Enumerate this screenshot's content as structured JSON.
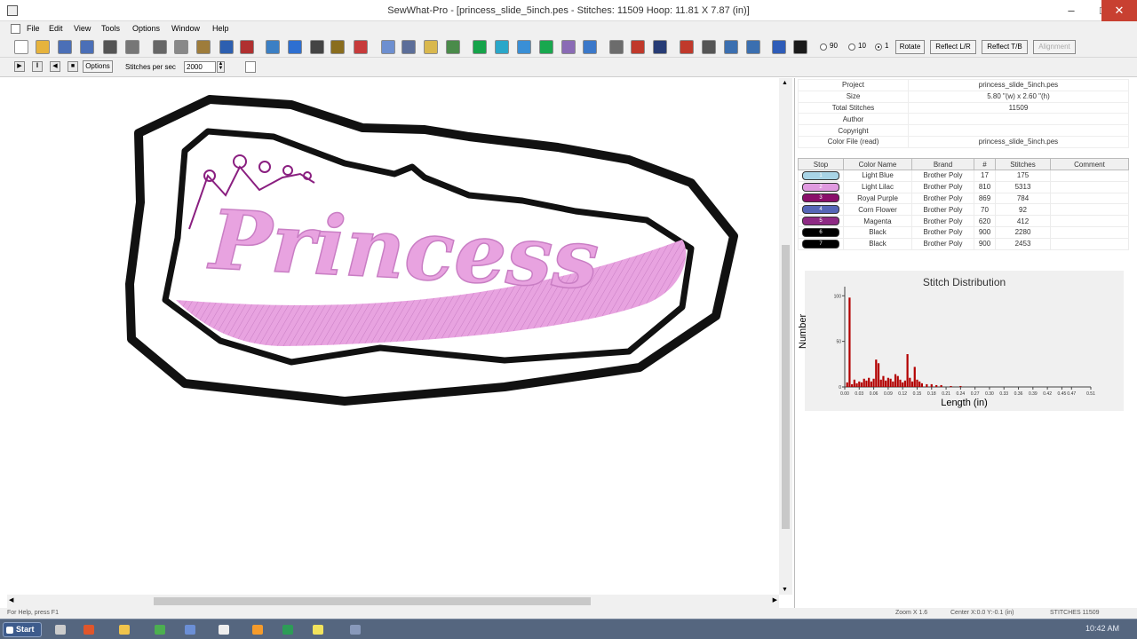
{
  "window": {
    "title": "SewWhat-Pro - [princess_slide_5inch.pes - Stitches: 11509  Hoop: 11.81 X 7.87 (in)]",
    "min_glyph": "–",
    "max_glyph": "□",
    "close_glyph": "✕"
  },
  "menu": [
    "File",
    "Edit",
    "View",
    "Tools",
    "Options",
    "Window",
    "Help"
  ],
  "toolbar": {
    "icons": [
      {
        "name": "new-file-icon",
        "color": "#ffffff"
      },
      {
        "name": "open-folder-icon",
        "color": "#e6b33d"
      },
      {
        "name": "save-icon",
        "color": "#4b6fb7"
      },
      {
        "name": "save-as-icon",
        "color": "#4b6fb7"
      },
      {
        "name": "print-icon",
        "color": "#555555"
      },
      {
        "name": "print-preview-icon",
        "color": "#777777"
      },
      {
        "name": "cut-icon",
        "color": "#666666"
      },
      {
        "name": "copy-icon",
        "color": "#888888"
      },
      {
        "name": "paste-icon",
        "color": "#9e7c3b"
      },
      {
        "name": "undo-icon",
        "color": "#2d5fb0"
      },
      {
        "name": "edit-stitches-icon",
        "color": "#b03030"
      },
      {
        "name": "hoop-icon",
        "color": "#3b7fc4"
      },
      {
        "name": "split-icon",
        "color": "#2e6fd1"
      },
      {
        "name": "text-icon",
        "color": "#444444"
      },
      {
        "name": "wizard-icon",
        "color": "#8a6d1e"
      },
      {
        "name": "tools-icon",
        "color": "#c73b3b"
      },
      {
        "name": "disk-icon",
        "color": "#6d8fd0"
      },
      {
        "name": "save-disk-icon",
        "color": "#5c6e99"
      },
      {
        "name": "flag-icon",
        "color": "#d9b84e"
      },
      {
        "name": "image-icon",
        "color": "#4a8b4a"
      },
      {
        "name": "stop-icon",
        "color": "#16a34a"
      },
      {
        "name": "shirt-icon",
        "color": "#2aa7c9"
      },
      {
        "name": "frame-icon",
        "color": "#3a8fd6"
      },
      {
        "name": "color-icon",
        "color": "#19a84f"
      },
      {
        "name": "paint-icon",
        "color": "#8a6bb5"
      },
      {
        "name": "needle-icon",
        "color": "#3b78c9"
      },
      {
        "name": "thread-icon",
        "color": "#6c6c6c"
      },
      {
        "name": "thread-red-icon",
        "color": "#c0392b"
      },
      {
        "name": "thread-blue-icon",
        "color": "#273c75"
      },
      {
        "name": "grid-icon",
        "color": "#c0392b"
      },
      {
        "name": "zoom-icon",
        "color": "#555555"
      },
      {
        "name": "zoom-in-icon",
        "color": "#3b6fb0"
      },
      {
        "name": "zoom-out-icon",
        "color": "#3b6fb0"
      },
      {
        "name": "help-icon",
        "color": "#2e5cb8"
      },
      {
        "name": "context-help-icon",
        "color": "#1a1a1a"
      }
    ],
    "rot90_label": "90",
    "rot10_label": "10",
    "rot1_label": "1",
    "rotate_label": "Rotate",
    "reflect_lr_label": "Reflect L/R",
    "reflect_tb_label": "Reflect T/B",
    "alignment_label": "Alignment"
  },
  "playbar": {
    "play_glyph": "▶",
    "pause_glyph": "‖",
    "back_glyph": "◀",
    "stop_glyph": "■",
    "options_label": "Options",
    "speed_label": "Stitches per sec",
    "speed_value": "2000"
  },
  "design": {
    "text": "Princess",
    "text_color": "#e8a3e0",
    "swoosh_color": "#dc8fd6",
    "crown_color": "#8a1f80",
    "border_color": "#111111"
  },
  "project": {
    "rows": [
      {
        "label": "Project",
        "value": "princess_slide_5inch.pes"
      },
      {
        "label": "Size",
        "value": "5.80 \"(w) x 2.60 \"(h)"
      },
      {
        "label": "Total Stitches",
        "value": "11509"
      },
      {
        "label": "Author",
        "value": ""
      },
      {
        "label": "Copyright",
        "value": ""
      },
      {
        "label": "Color File (read)",
        "value": "princess_slide_5inch.pes"
      }
    ]
  },
  "colors": {
    "headers": [
      "Stop",
      "Color Name",
      "Brand",
      "#",
      "Stitches",
      "Comment"
    ],
    "rows": [
      {
        "stop": "1",
        "hex": "#a8d4e6",
        "name": "Light Blue",
        "brand": "Brother Poly",
        "num": "17",
        "stitches": "175",
        "comment": ""
      },
      {
        "stop": "2",
        "hex": "#e09ae0",
        "name": "Light Lilac",
        "brand": "Brother Poly",
        "num": "810",
        "stitches": "5313",
        "comment": ""
      },
      {
        "stop": "3",
        "hex": "#8a0f6a",
        "name": "Royal Purple",
        "brand": "Brother Poly",
        "num": "869",
        "stitches": "784",
        "comment": ""
      },
      {
        "stop": "4",
        "hex": "#5566b7",
        "name": "Corn Flower",
        "brand": "Brother Poly",
        "num": "70",
        "stitches": "92",
        "comment": ""
      },
      {
        "stop": "5",
        "hex": "#8e2a84",
        "name": "Magenta",
        "brand": "Brother Poly",
        "num": "620",
        "stitches": "412",
        "comment": ""
      },
      {
        "stop": "6",
        "hex": "#000000",
        "name": "Black",
        "brand": "Brother Poly",
        "num": "900",
        "stitches": "2280",
        "comment": ""
      },
      {
        "stop": "7",
        "hex": "#000000",
        "name": "Black",
        "brand": "Brother Poly",
        "num": "900",
        "stitches": "2453",
        "comment": ""
      }
    ]
  },
  "chart_data": {
    "type": "bar",
    "title": "Stitch Distribution",
    "xlabel": "Length (in)",
    "ylabel": "Number",
    "x_ticks": [
      "0.00",
      "0.03",
      "0.06",
      "0.09",
      "0.12",
      "0.15",
      "0.18",
      "0.21",
      "0.24",
      "0.27",
      "0.30",
      "0.33",
      "0.36",
      "0.39",
      "0.42",
      "0.45",
      "0.47",
      "0.51"
    ],
    "y_ticks": [
      "0",
      "50",
      "100"
    ],
    "ylim": [
      0,
      110
    ],
    "xlim": [
      0,
      0.51
    ],
    "x": [
      0.005,
      0.01,
      0.015,
      0.02,
      0.025,
      0.03,
      0.035,
      0.04,
      0.045,
      0.05,
      0.055,
      0.06,
      0.065,
      0.07,
      0.075,
      0.08,
      0.085,
      0.09,
      0.095,
      0.1,
      0.105,
      0.11,
      0.115,
      0.12,
      0.125,
      0.13,
      0.135,
      0.14,
      0.145,
      0.15,
      0.155,
      0.16,
      0.17,
      0.18,
      0.19,
      0.2,
      0.22,
      0.24
    ],
    "values": [
      5,
      98,
      3,
      8,
      4,
      6,
      5,
      9,
      7,
      10,
      6,
      9,
      30,
      26,
      8,
      12,
      7,
      10,
      9,
      6,
      14,
      12,
      8,
      5,
      7,
      36,
      10,
      6,
      22,
      8,
      6,
      4,
      3,
      3,
      2,
      2,
      1,
      1
    ]
  },
  "status": {
    "help": "For Help, press F1",
    "zoom": "Zoom X 1.6",
    "center": "Center X:0.0 Y:-0.1 (in)",
    "stitches": "STITCHES 11509"
  },
  "taskbar": {
    "start_label": "Start",
    "clock": "10:42 AM",
    "apps": [
      {
        "name": "task-calculator-icon",
        "color": "#cccccc"
      },
      {
        "name": "task-firefox-icon",
        "color": "#e0562b"
      },
      {
        "name": "task-folder-icon",
        "color": "#f0c44c"
      },
      {
        "name": "task-chrome-icon",
        "color": "#4caf50"
      },
      {
        "name": "task-files-icon",
        "color": "#6b8fd6"
      },
      {
        "name": "task-paint-icon",
        "color": "#eeeeee"
      },
      {
        "name": "task-media-icon",
        "color": "#f59b2b"
      },
      {
        "name": "task-app-icon",
        "color": "#2d9c57"
      },
      {
        "name": "task-notes-icon",
        "color": "#f2e35c"
      },
      {
        "name": "task-sewwhat-icon",
        "color": "#8899bb"
      }
    ]
  }
}
